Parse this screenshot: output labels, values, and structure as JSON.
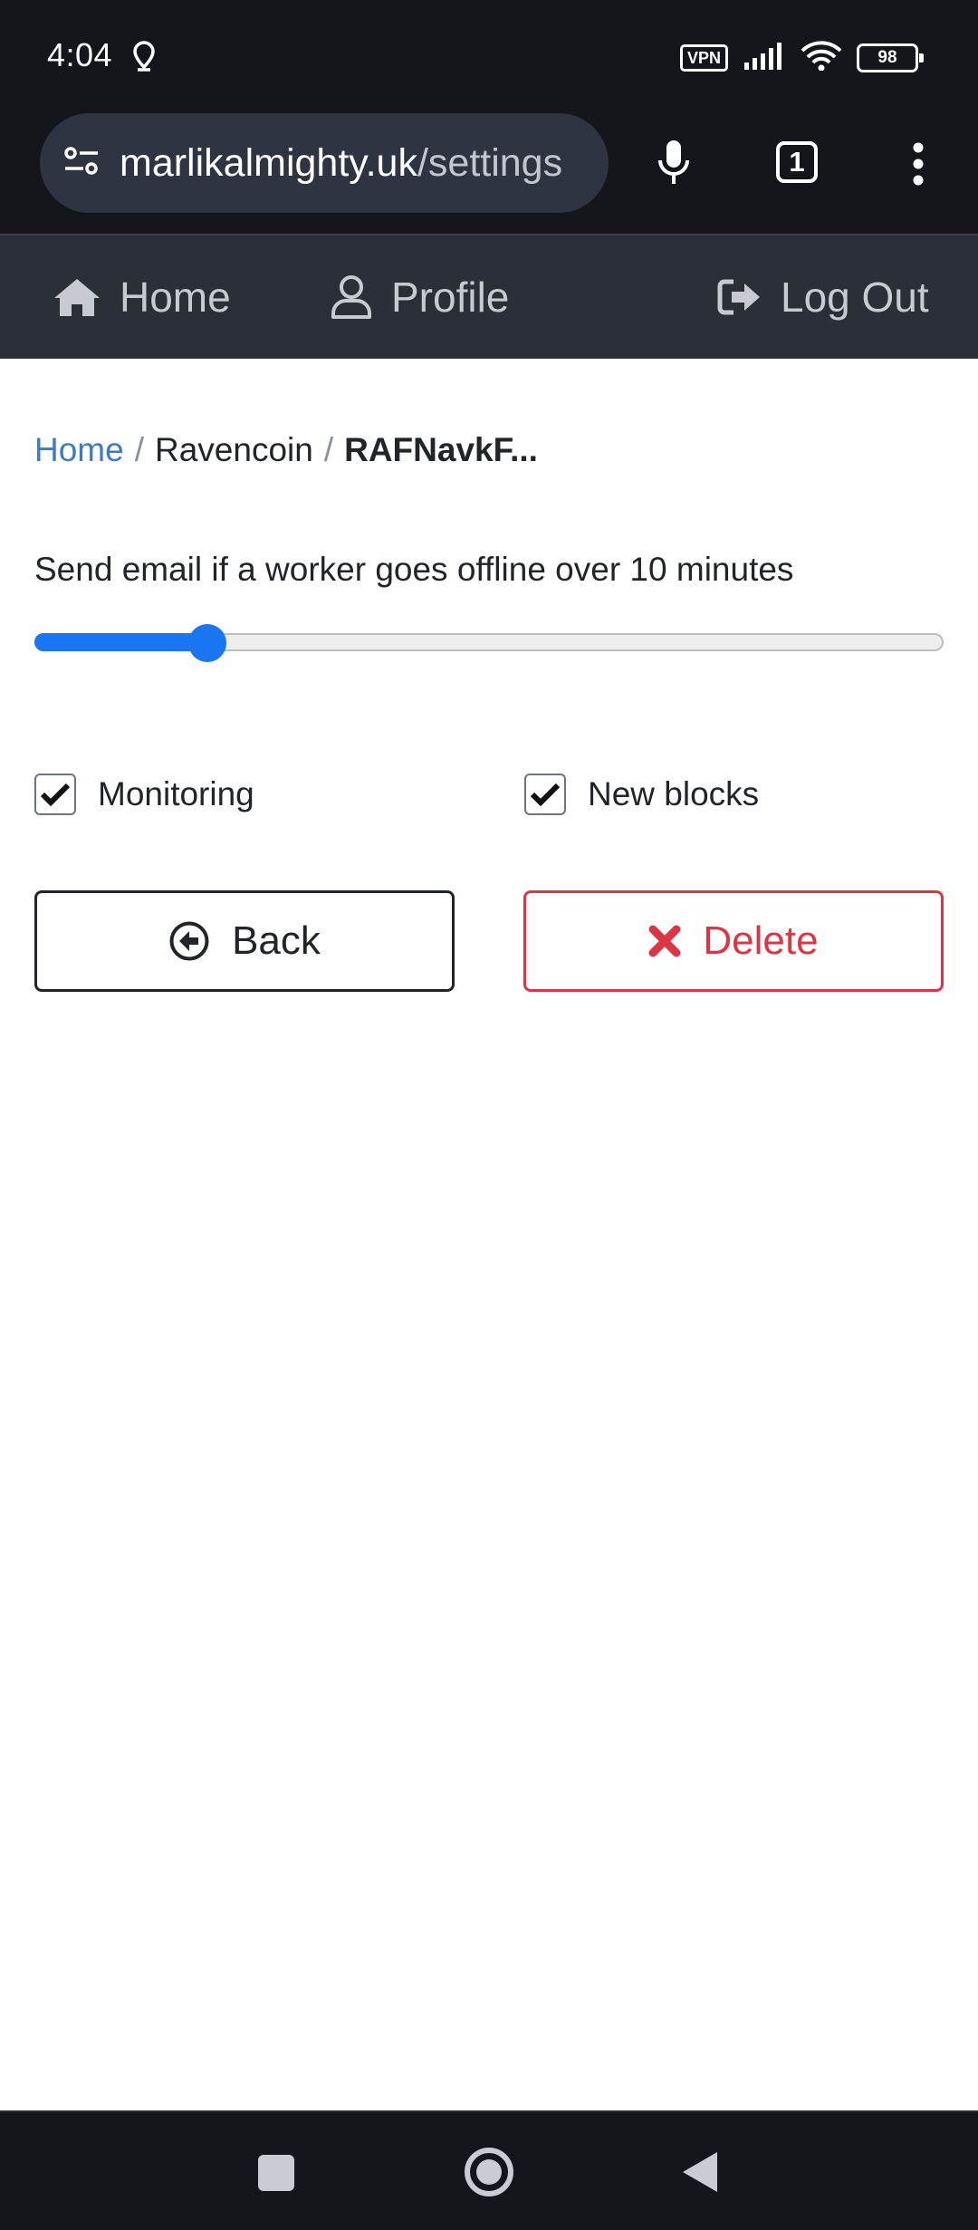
{
  "status_bar": {
    "time": "4:04",
    "vpn_label": "VPN",
    "battery_level": "98",
    "icons": [
      "location-icon",
      "vpn-icon",
      "signal-icon",
      "wifi-icon",
      "battery-icon"
    ]
  },
  "browser": {
    "url_domain": "marlikalmighty.uk",
    "url_path": "/settings",
    "tab_count": "1",
    "icons": [
      "site-settings-icon",
      "microphone-icon",
      "tabs-icon",
      "more-vert-icon"
    ]
  },
  "nav": {
    "home_label": "Home",
    "profile_label": "Profile",
    "logout_label": "Log Out"
  },
  "breadcrumb": {
    "home": "Home",
    "separator": "/",
    "coin": "Ravencoin",
    "current": "RAFNavkF..."
  },
  "settings": {
    "offline_label": "Send email if a worker goes offline over 10 minutes",
    "offline_slider_fraction": 0.19,
    "monitoring_label": "Monitoring",
    "monitoring_checked": true,
    "new_blocks_label": "New blocks",
    "new_blocks_checked": true
  },
  "actions": {
    "back_label": "Back",
    "delete_label": "Delete"
  },
  "colors": {
    "accent_blue": "#1976f0",
    "link_blue": "#3d7cc2",
    "danger_red": "#dc3545",
    "nav_bg": "#2b2f38",
    "system_bar_bg": "#14161c"
  }
}
